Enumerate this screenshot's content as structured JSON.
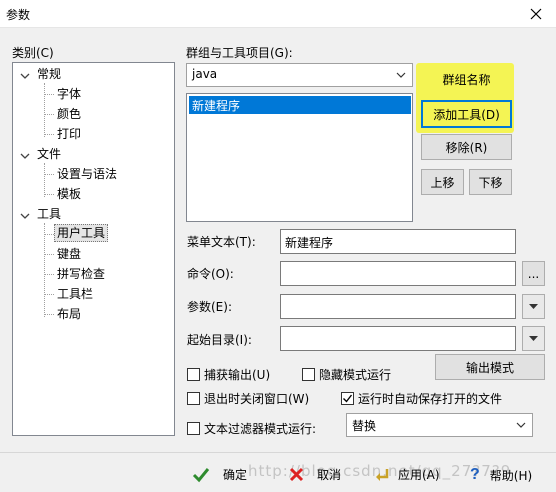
{
  "window": {
    "title": "参数",
    "close_glyph": "✕"
  },
  "category_label": "类别(C)",
  "tree": {
    "general": "常规",
    "font": "字体",
    "color": "颜色",
    "print": "打印",
    "file": "文件",
    "settings_syntax": "设置与语法",
    "template": "模板",
    "tools": "工具",
    "user_tools": "用户工具",
    "keyboard": "键盘",
    "spellcheck": "拼写检查",
    "toolbar": "工具栏",
    "layout": "布局"
  },
  "group": {
    "label": "群组与工具项目(G):",
    "selected": "java",
    "items": [
      "新建程序"
    ]
  },
  "buttons": {
    "group_name": "群组名称",
    "add_tool": "添加工具(D)",
    "remove": "移除(R)",
    "move_up": "上移",
    "move_down": "下移",
    "output_mode": "输出模式",
    "browse": "..."
  },
  "fields": {
    "menu_text_label": "菜单文本(T):",
    "menu_text_value": "新建程序",
    "command_label": "命令(O):",
    "command_value": "",
    "args_label": "参数(E):",
    "args_value": "",
    "start_dir_label": "起始目录(I):",
    "start_dir_value": ""
  },
  "checks": {
    "capture_output": "捕获输出(U)",
    "hide_mode": "隐藏模式运行",
    "close_on_exit": "退出时关闭窗口(W)",
    "autosave": "运行时自动保存打开的文件",
    "text_filter": "文本过滤器模式运行:",
    "autosave_checked": true
  },
  "filter_mode": {
    "selected": "替换"
  },
  "footer": {
    "ok": "确定",
    "cancel": "取消",
    "apply": "应用(A)",
    "help": "帮助(H)",
    "watermark": "http://blog.csdn.net/qq_27?7?9"
  },
  "colors": {
    "accent": "#0078d7",
    "highlight": "#f4f442"
  }
}
